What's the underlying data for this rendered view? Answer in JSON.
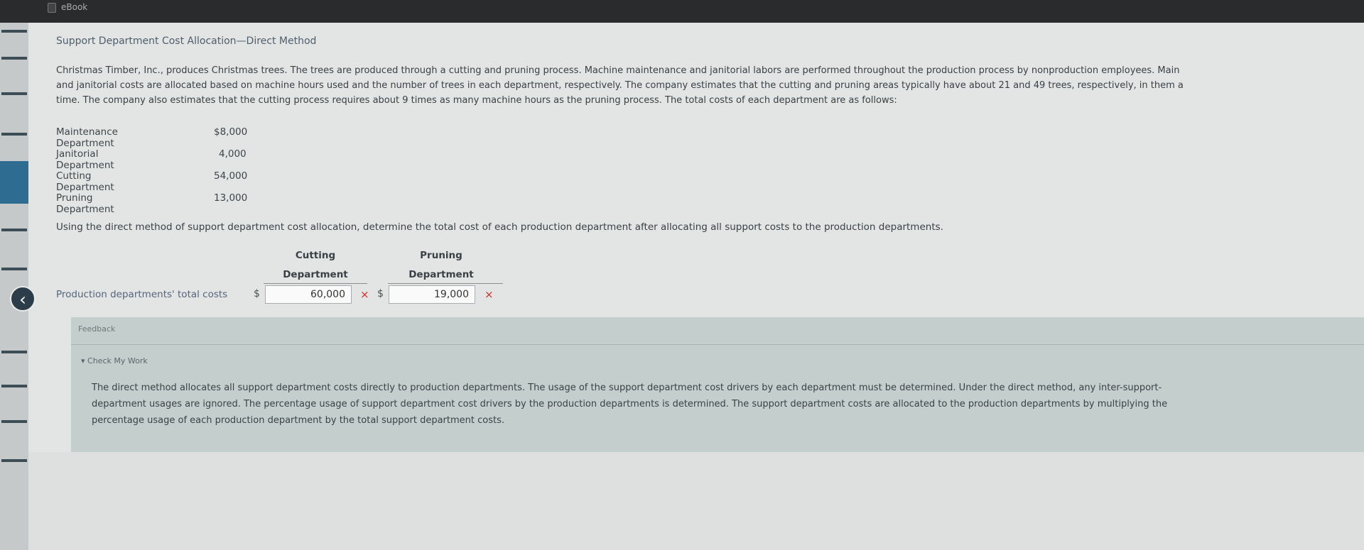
{
  "window": {
    "tab_title": "eBook"
  },
  "section": {
    "title": "Support Department Cost Allocation—Direct Method"
  },
  "intro_lines": [
    "Christmas Timber, Inc., produces Christmas trees. The trees are produced through a cutting and pruning process. Machine maintenance and janitorial labors are performed throughout the production process by nonproduction employees. Main",
    "and janitorial costs are allocated based on machine hours used and the number of trees in each department, respectively. The company estimates that the cutting and pruning areas typically have about 21 and 49 trees, respectively, in them a",
    "time. The company also estimates that the cutting process requires about 9 times as many machine hours as the pruning process. The total costs of each department are as follows:"
  ],
  "costs": [
    {
      "label": "Maintenance Department",
      "value": "$8,000"
    },
    {
      "label": "Janitorial Department",
      "value": "4,000"
    },
    {
      "label": "Cutting Department",
      "value": "54,000"
    },
    {
      "label": "Pruning Department",
      "value": "13,000"
    }
  ],
  "instruction": "Using the direct method of support department cost allocation, determine the total cost of each production department after allocating all support costs to the production departments.",
  "answer_table": {
    "columns": [
      {
        "line1": "Cutting",
        "line2": "Department"
      },
      {
        "line1": "Pruning",
        "line2": "Department"
      }
    ],
    "row_label": "Production departments' total costs",
    "currency": "$",
    "cutting_value": "60,000",
    "pruning_value": "19,000",
    "wrong_mark": "×"
  },
  "feedback": {
    "title": "Feedback",
    "check_title": "Check My Work",
    "lines": [
      "The direct method allocates all support department costs directly to production departments. The usage of the support department cost drivers by each department must be determined. Under the direct method, any inter-support-",
      "department usages are ignored. The percentage usage of support department cost drivers by the production departments is determined. The support department costs are allocated to the production departments by multiplying the",
      "percentage usage of each production department by the total support department costs."
    ]
  },
  "icons": {
    "back": "chevron-left-icon",
    "triangle": "triangle-down-icon",
    "tab": "page-icon",
    "wrong": "x-mark-icon"
  },
  "colors": {
    "error": "#d12b2b",
    "feedback_bg": "#c4cecd",
    "accent_blue": "#2e6c92"
  }
}
